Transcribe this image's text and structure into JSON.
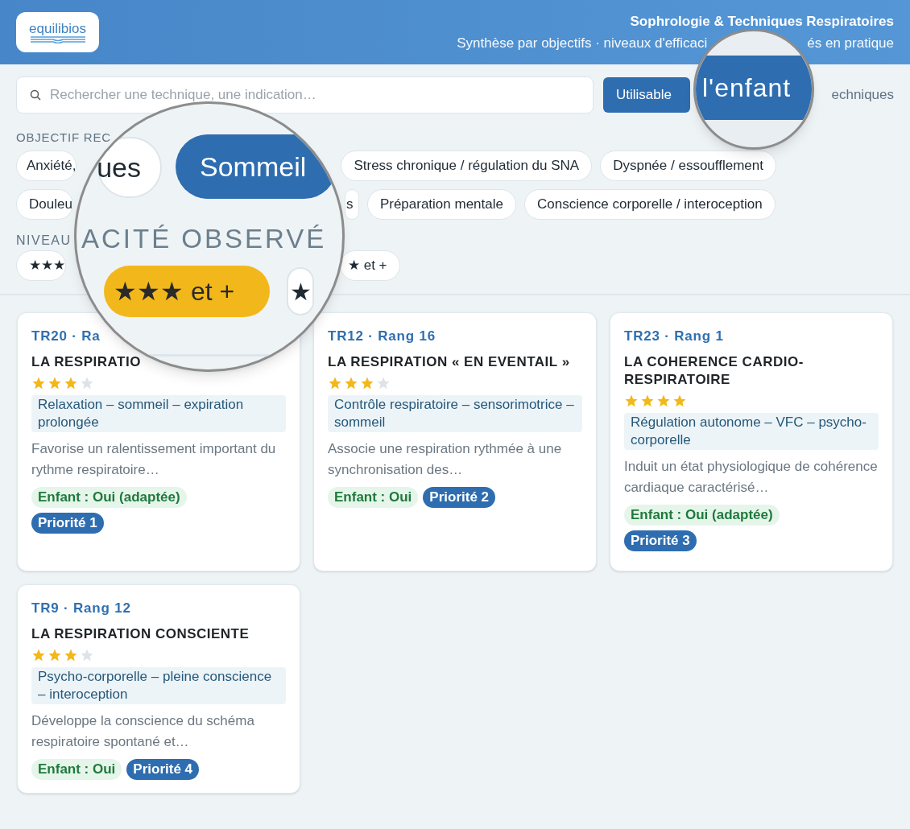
{
  "header": {
    "logo": "equilibios",
    "title": "Sophrologie & Techniques Respiratoires",
    "subtitle_parts": [
      "Synthèse par objectifs · niveaux d'efficaci",
      "és en pratique"
    ]
  },
  "search": {
    "placeholder": "Rechercher une technique, une indication…"
  },
  "child_filter": {
    "label": "Utilisable",
    "selected": true
  },
  "count": "echniques",
  "objective_label": "OBJECTIF REC",
  "objective_rows": [
    [
      {
        "label": "Anxiété,",
        "selected": false
      },
      {
        "label": "Stress chronique / régulation du SNA",
        "selected": false
      },
      {
        "label": "Dyspnée / essoufflement",
        "selected": false
      }
    ],
    [
      {
        "label": "Douleu",
        "selected": false
      },
      {
        "label": "s",
        "selected": false
      },
      {
        "label": "Préparation mentale",
        "selected": false
      },
      {
        "label": "Conscience corporelle / interoception",
        "selected": false
      }
    ]
  ],
  "level_label": "NIVEAU",
  "levels": [
    {
      "label": "★★★",
      "selected": false
    },
    {
      "label": "★ et +",
      "selected": false
    }
  ],
  "magnifier_right": {
    "button": {
      "label": "l'enfant",
      "selected": true
    }
  },
  "magnifier_left": {
    "objective_chips": [
      {
        "label": "ues",
        "selected": false
      },
      {
        "label": "Sommeil",
        "selected": true
      }
    ],
    "level_label": "ACITÉ OBSERVÉ",
    "level_chips": [
      {
        "label": "★★★ et +",
        "selected": true
      },
      {
        "label": "★",
        "selected": false
      }
    ]
  },
  "cards": [
    {
      "ref": "TR20 · Ra",
      "title": "LA RESPIRATIO",
      "stars": 3,
      "tag": "Relaxation – sommeil – expiration prolongée",
      "description": "Favorise un ralentissement important du rythme respiratoire…",
      "child": "Enfant : Oui (adaptée)",
      "priority": "Priorité 1"
    },
    {
      "ref": "TR12 · Rang 16",
      "title": "LA RESPIRATION « EN EVENTAIL »",
      "stars": 3,
      "tag": "Contrôle respiratoire – sensorimotrice – sommeil",
      "description": "Associe une respiration rythmée à une synchronisation des…",
      "child": "Enfant : Oui",
      "priority": "Priorité 2"
    },
    {
      "ref": "TR23 · Rang 1",
      "title": "LA COHERENCE CARDIO-RESPIRATOIRE",
      "stars": 4,
      "tag": "Régulation autonome – VFC – psycho-corporelle",
      "description": "Induit un état physiologique de cohérence cardiaque caractérisé…",
      "child": "Enfant : Oui (adaptée)",
      "priority": "Priorité 3"
    },
    {
      "ref": "TR9 · Rang 12",
      "title": "LA RESPIRATION CONSCIENTE",
      "stars": 3,
      "tag": "Psycho-corporelle – pleine conscience – interoception",
      "description": "Développe la conscience du schéma respiratoire spontané et…",
      "child": "Enfant : Oui",
      "priority": "Priorité 4"
    }
  ]
}
